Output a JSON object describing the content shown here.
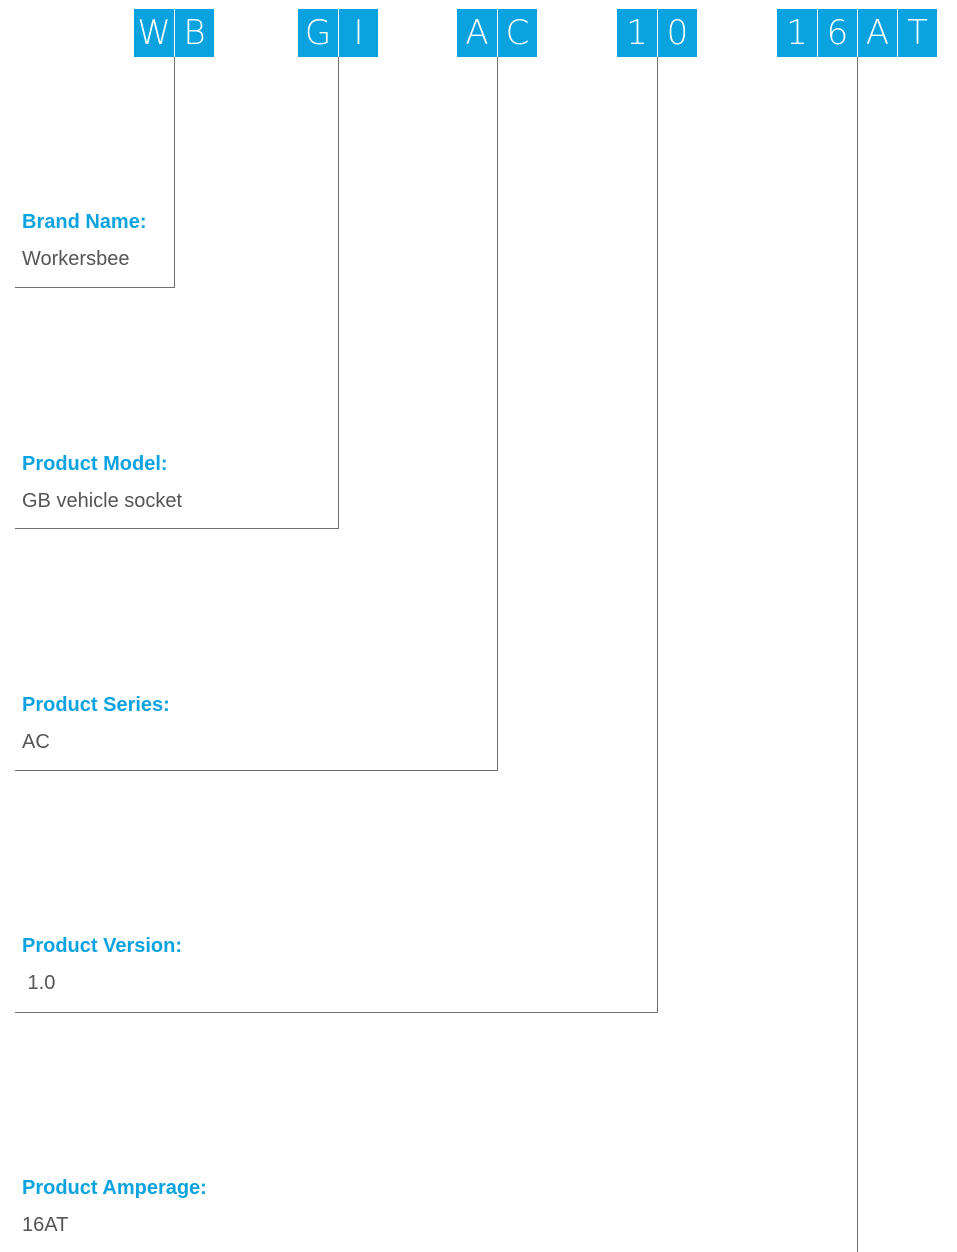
{
  "colors": {
    "accent": "#0aa3e0",
    "cell_text": "#ffffff",
    "connector": "#6e6e6e",
    "value_text": "#555555"
  },
  "code_groups": [
    {
      "chars": [
        "W",
        "B"
      ]
    },
    {
      "chars": [
        "G",
        "I"
      ]
    },
    {
      "chars": [
        "A",
        "C"
      ]
    },
    {
      "chars": [
        "1",
        "0"
      ]
    },
    {
      "chars": [
        "1",
        "6",
        "A",
        "T"
      ]
    }
  ],
  "fields": [
    {
      "label": "Brand Name:",
      "value": "Workersbee"
    },
    {
      "label": "Product Model:",
      "value": "GB vehicle socket"
    },
    {
      "label": "Product Series:",
      "value": "AC"
    },
    {
      "label": "Product Version:",
      "value": " 1.0"
    },
    {
      "label": "Product Amperage:",
      "value": "16AT"
    }
  ]
}
